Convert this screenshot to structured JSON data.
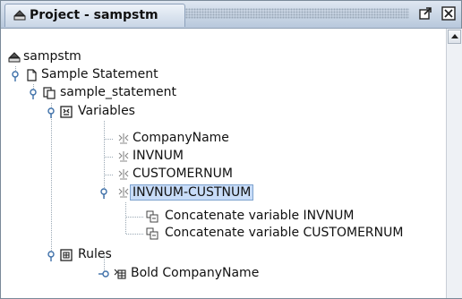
{
  "window": {
    "title": "Project - sampstm",
    "undock_icon": "undock-icon",
    "close_icon": "close-icon"
  },
  "tree": {
    "root": {
      "label": "sampstm",
      "icon": "project-icon"
    },
    "statement": {
      "label": "Sample Statement",
      "icon": "document-icon"
    },
    "statement_file": {
      "label": "sample_statement",
      "icon": "copy-document-icon"
    },
    "variables": {
      "label": "Variables",
      "icon": "variables-folder-icon",
      "items": [
        {
          "label": "CompanyName",
          "icon": "variable-icon"
        },
        {
          "label": "INVNUM",
          "icon": "variable-icon"
        },
        {
          "label": "CUSTOMERNUM",
          "icon": "variable-icon"
        },
        {
          "label": "INVNUM-CUSTNUM",
          "icon": "variable-icon",
          "selected": true
        }
      ],
      "sub_items": [
        {
          "label": "Concatenate variable INVNUM",
          "icon": "concatenate-icon"
        },
        {
          "label": "Concatenate variable CUSTOMERNUM",
          "icon": "concatenate-icon"
        }
      ]
    },
    "rules": {
      "label": "Rules",
      "icon": "rules-folder-icon",
      "items": [
        {
          "label": "Bold CompanyName",
          "icon": "rule-icon"
        }
      ]
    }
  },
  "colors": {
    "selection_bg": "#c8dcf8",
    "selection_border": "#7da2ce",
    "titlebar": "#c9d6e6"
  }
}
